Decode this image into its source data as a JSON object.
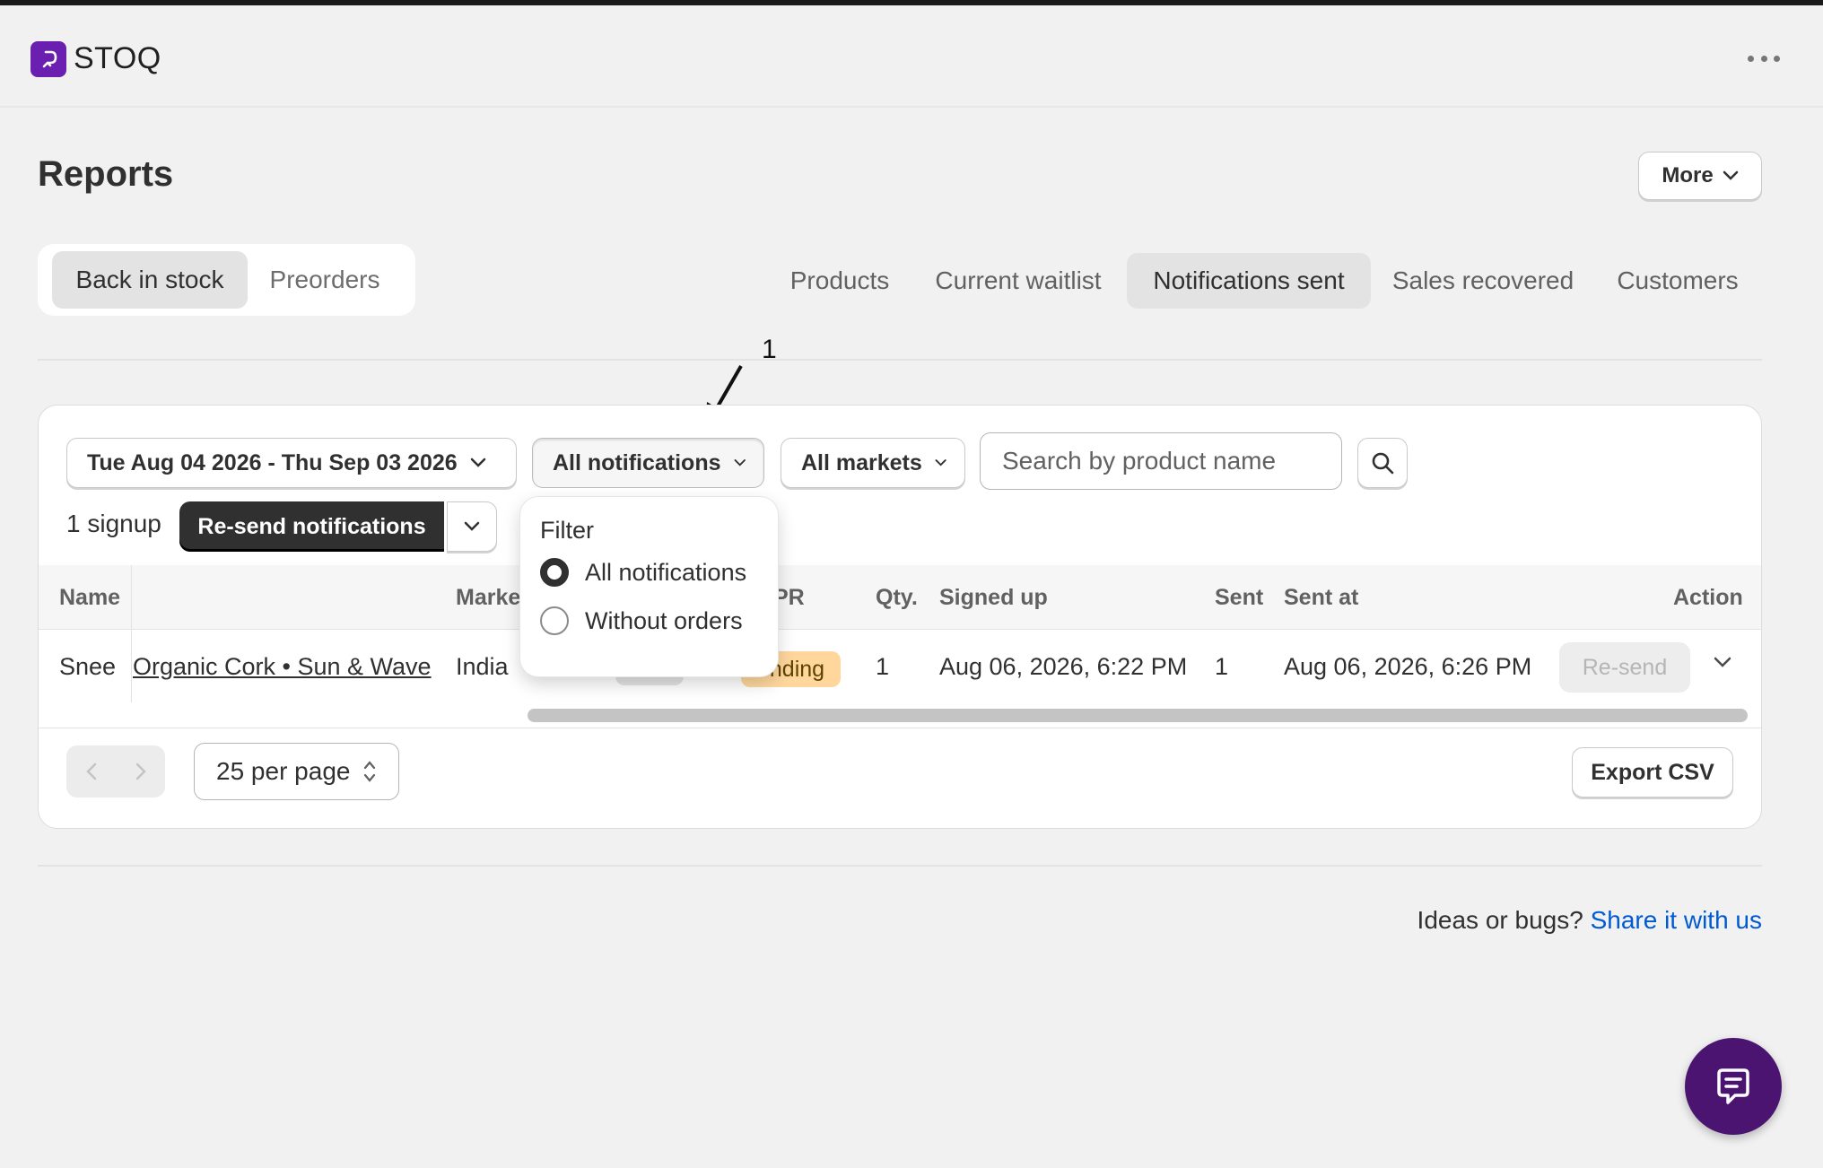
{
  "app": {
    "name": "STOQ"
  },
  "page": {
    "title": "Reports",
    "more_label": "More"
  },
  "segment": {
    "items": [
      "Back in stock",
      "Preorders"
    ],
    "active": "Back in stock"
  },
  "tabs": {
    "items": [
      "Products",
      "Current waitlist",
      "Notifications sent",
      "Sales recovered",
      "Customers"
    ],
    "active": "Notifications sent"
  },
  "annotation": {
    "label": "1"
  },
  "filters": {
    "date_range": "Tue Aug 04 2026 - Thu Sep 03 2026",
    "notifications": "All notifications",
    "markets": "All markets",
    "search_placeholder": "Search by product name"
  },
  "bulk": {
    "count_label": "1 signup",
    "resend_label": "Re-send notifications"
  },
  "popover": {
    "title": "Filter",
    "options": [
      {
        "label": "All notifications",
        "checked": true
      },
      {
        "label": "Without orders",
        "checked": false
      }
    ]
  },
  "table": {
    "headers": {
      "name": "Name",
      "market": "Marke",
      "pr": "PR",
      "qty": "Qty.",
      "signed_up": "Signed up",
      "sent": "Sent",
      "sent_at": "Sent at",
      "action": "Action"
    },
    "rows": [
      {
        "name": "Snee",
        "product": "Organic Cork • Sun & Wave",
        "market": "India",
        "status": "ending",
        "qty": "1",
        "signed_up": "Aug 06, 2026, 6:22 PM",
        "sent": "1",
        "sent_at": "Aug 06, 2026, 6:26 PM",
        "action": "Re-send"
      }
    ]
  },
  "footer": {
    "per_page": "25 per page",
    "export_label": "Export CSV"
  },
  "feedback": {
    "text": "Ideas or bugs?",
    "link": "Share it with us"
  },
  "colors": {
    "brand": "#6b1fb1",
    "chat": "#4a1470",
    "link": "#005bd3",
    "pending_bg": "#ffd79d",
    "primary_dark": "#303030"
  },
  "icons": {
    "logo": "stoq-logo-icon",
    "menu": "ellipsis-icon",
    "search": "search-icon",
    "chevron": "chevron-down-icon",
    "chat": "chat-bubble-icon"
  }
}
